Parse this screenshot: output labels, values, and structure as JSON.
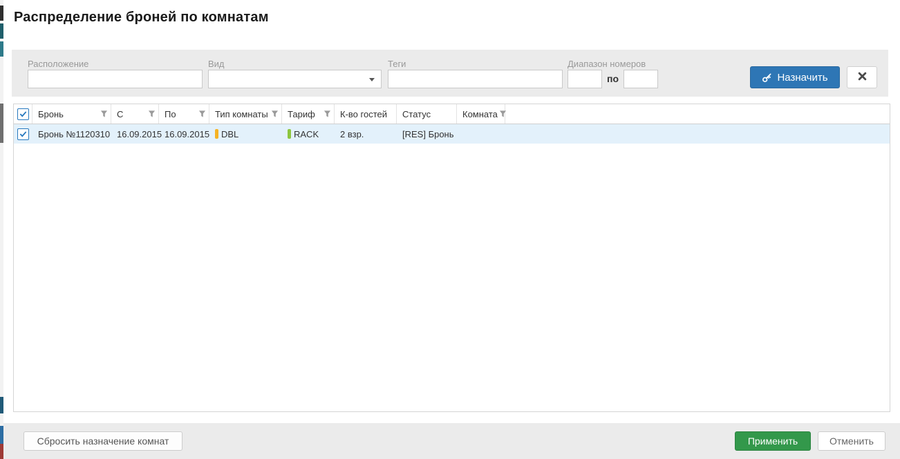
{
  "title": "Распределение броней по комнатам",
  "filters": {
    "location": {
      "label": "Расположение",
      "value": "",
      "placeholder": ""
    },
    "view": {
      "label": "Вид",
      "value": ""
    },
    "tags": {
      "label": "Теги",
      "value": "",
      "placeholder": ""
    },
    "range": {
      "label": "Диапазон номеров",
      "from_value": "",
      "to_label": "по",
      "to_value": ""
    }
  },
  "actions": {
    "assign_label": "Назначить"
  },
  "table": {
    "columns": [
      {
        "label": "Бронь",
        "filter": true
      },
      {
        "label": "С",
        "filter": true
      },
      {
        "label": "По",
        "filter": true
      },
      {
        "label": "Тип комнаты",
        "filter": true
      },
      {
        "label": "Тариф",
        "filter": true
      },
      {
        "label": "К-во гостей",
        "filter": false
      },
      {
        "label": "Статус",
        "filter": false
      },
      {
        "label": "Комната",
        "filter": true
      }
    ],
    "rows": [
      {
        "checked": true,
        "booking": "Бронь №1120310",
        "from": "16.09.2015",
        "to": "16.09.2015",
        "room_type": "DBL",
        "rate": "RACK",
        "guests": "2 взр.",
        "status": "[RES] Бронь",
        "room": ""
      }
    ]
  },
  "footer": {
    "reset_label": "Сбросить назначение комнат",
    "apply_label": "Применить",
    "cancel_label": "Отменить"
  },
  "colors": {
    "accent_blue": "#2e76b5",
    "accent_green": "#33984b",
    "selected_row_bg": "#e3f1fb",
    "bar_bg": "#ebebeb",
    "room_type_marker": "#f5b324",
    "rate_marker": "#8dc63f",
    "checkbox_blue": "#2778be"
  }
}
